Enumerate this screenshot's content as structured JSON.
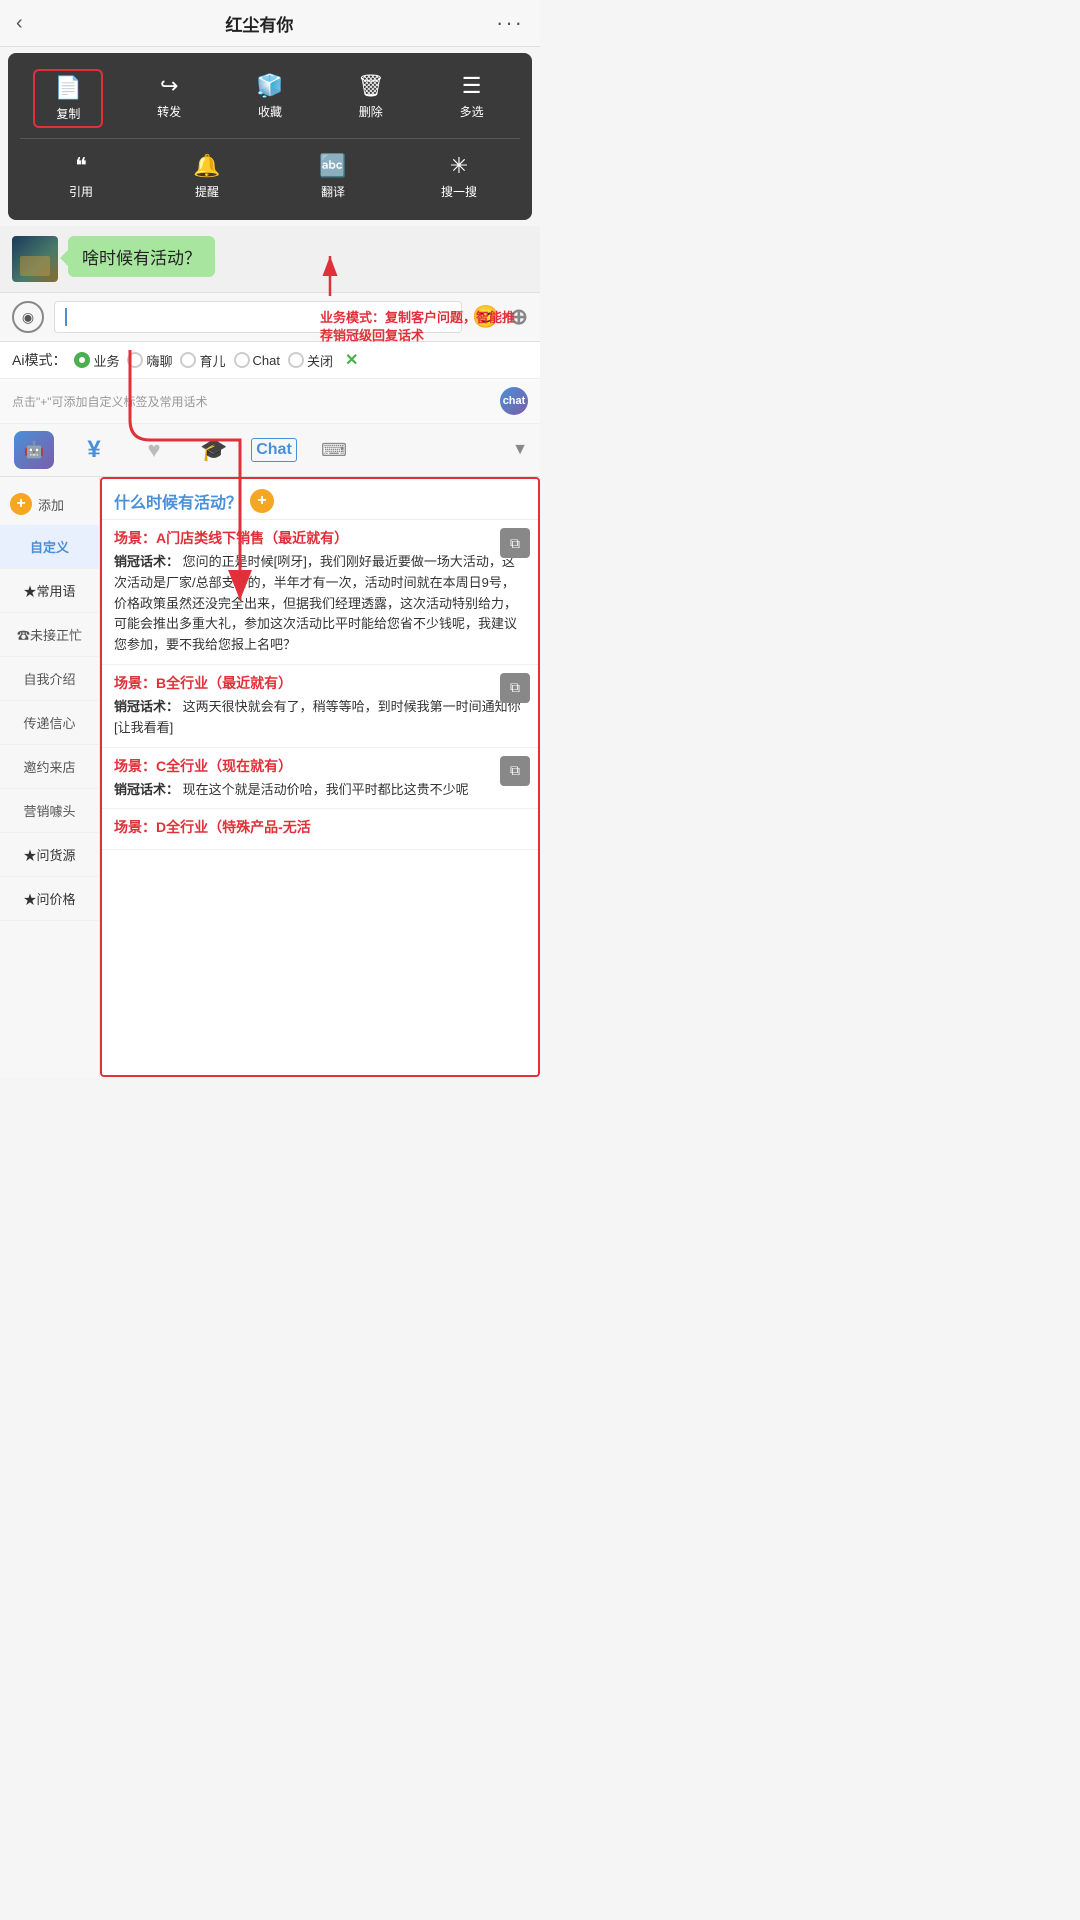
{
  "topNav": {
    "title": "红尘有你",
    "backLabel": "‹",
    "moreLabel": "···"
  },
  "contextMenu": {
    "row1": [
      {
        "id": "copy",
        "icon": "📄",
        "label": "复制",
        "highlighted": true
      },
      {
        "id": "forward",
        "icon": "↪",
        "label": "转发",
        "highlighted": false
      },
      {
        "id": "collect",
        "icon": "🧊",
        "label": "收藏",
        "highlighted": false
      },
      {
        "id": "delete",
        "icon": "🗑",
        "label": "删除",
        "highlighted": false
      },
      {
        "id": "multiselect",
        "icon": "☰",
        "label": "多选",
        "highlighted": false
      }
    ],
    "row2": [
      {
        "id": "quote",
        "icon": "❝",
        "label": "引用",
        "highlighted": false
      },
      {
        "id": "remind",
        "icon": "🔔",
        "label": "提醒",
        "highlighted": false
      },
      {
        "id": "translate",
        "icon": "🔤",
        "label": "翻译",
        "highlighted": false
      },
      {
        "id": "search",
        "icon": "✳",
        "label": "搜一搜",
        "highlighted": false
      }
    ]
  },
  "chat": {
    "bubbleText": "啥时候有活动？",
    "annotationText": "业务模式：复制客户问题，智能推荐销冠级回复话术"
  },
  "inputBar": {
    "placeholder": ""
  },
  "aiMode": {
    "label": "Ai模式：",
    "options": [
      {
        "id": "business",
        "label": "业务",
        "active": true
      },
      {
        "id": "chat2",
        "label": "嗨聊",
        "active": false
      },
      {
        "id": "parenting",
        "label": "育儿",
        "active": false
      },
      {
        "id": "chat",
        "label": "Chat",
        "active": false
      },
      {
        "id": "off",
        "label": "关闭",
        "active": false
      }
    ],
    "closeLabel": "✕"
  },
  "addTagsRow": {
    "text": "点击\"+\"可添加自定义标签及常用话术",
    "badgeLabel": "chat"
  },
  "sidebar": {
    "addLabel": "添加",
    "items": [
      {
        "id": "custom",
        "label": "自定义",
        "active": true
      },
      {
        "id": "common",
        "label": "★常用语",
        "active": false
      },
      {
        "id": "busy",
        "label": "☎未接正忙",
        "active": false
      },
      {
        "id": "intro",
        "label": "自我介绍",
        "active": false
      },
      {
        "id": "confidence",
        "label": "传递信心",
        "active": false
      },
      {
        "id": "invite",
        "label": "邀约来店",
        "active": false
      },
      {
        "id": "marketing",
        "label": "营销噱头",
        "active": false
      },
      {
        "id": "source",
        "label": "★问货源",
        "active": false
      },
      {
        "id": "price",
        "label": "★问价格",
        "active": false
      }
    ]
  },
  "mainContent": {
    "questionHeader": {
      "questionText": "什么时候有活动？",
      "plusLabel": "+"
    },
    "scenarios": [
      {
        "id": "A",
        "title": "场景：A门店类线下销售（最近就有）",
        "bodyLabel": "销冠话术：",
        "bodyText": "您问的正是时候[咧牙]，我们刚好最近要做一场大活动，这次活动是厂家/总部支持的，半年才有一次，活动时间就在本周日9号，价格政策虽然还没完全出来，但据我们经理透露，这次活动特别给力，可能会推出多重大礼，参加这次活动比平时能给您省不少钱呢，我建议您参加，要不我给您报上名吧？"
      },
      {
        "id": "B",
        "title": "场景：B全行业（最近就有）",
        "bodyLabel": "销冠话术：",
        "bodyText": "这两天很快就会有了，稍等等哈，到时候我第一时间通知你[让我看看]"
      },
      {
        "id": "C",
        "title": "场景：C全行业（现在就有）",
        "bodyLabel": "销冠话术：",
        "bodyText": "现在这个就是活动价哈，我们平时都比这贵不少呢"
      },
      {
        "id": "D",
        "title": "场景：D全行业（特殊产品-无活",
        "bodyLabel": "",
        "bodyText": ""
      }
    ]
  }
}
